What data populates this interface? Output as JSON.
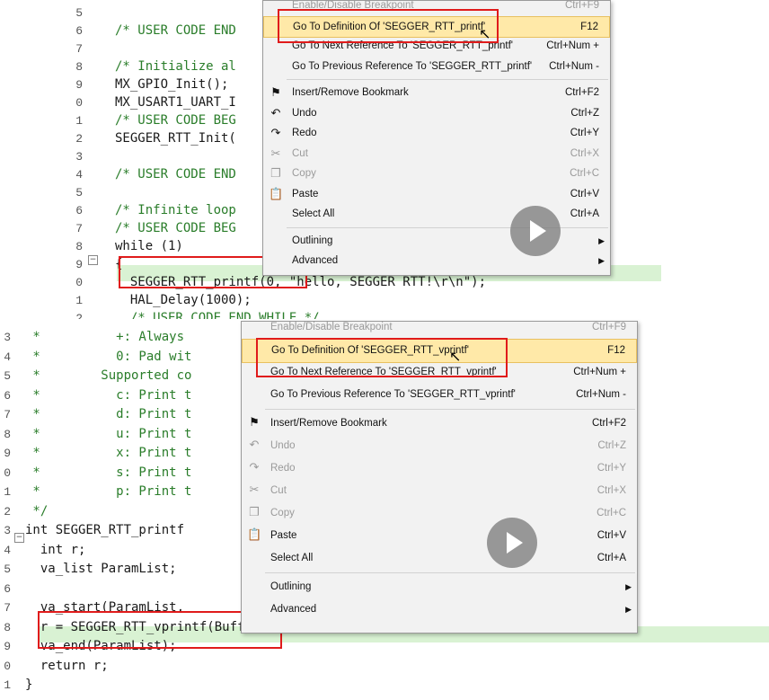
{
  "top_panel": {
    "code_lines": [
      {
        "ln": "5",
        "text": ""
      },
      {
        "ln": "6",
        "text": "/* USER CODE END",
        "cls": "cmt"
      },
      {
        "ln": "7",
        "text": ""
      },
      {
        "ln": "8",
        "text": "/* Initialize al",
        "cls": "cmt"
      },
      {
        "ln": "9",
        "text": "MX_GPIO_Init();"
      },
      {
        "ln": "0",
        "text": "MX_USART1_UART_I"
      },
      {
        "ln": "1",
        "text": "/* USER CODE BEG",
        "cls": "cmt"
      },
      {
        "ln": "2",
        "text": "SEGGER_RTT_Init("
      },
      {
        "ln": "3",
        "text": ""
      },
      {
        "ln": "4",
        "text": "/* USER CODE END",
        "cls": "cmt"
      },
      {
        "ln": "5",
        "text": ""
      },
      {
        "ln": "6",
        "text": "/* Infinite loop",
        "cls": "cmt"
      },
      {
        "ln": "7",
        "text": "/* USER CODE BEG",
        "cls": "cmt"
      },
      {
        "ln": "8",
        "text": "while (1)"
      },
      {
        "ln": "9",
        "text": "{"
      },
      {
        "ln": "0",
        "text": "  SEGGER_RTT_printf(0, \"hello, SEGGER RTT!\\r\\n\");"
      },
      {
        "ln": "1",
        "text": "  HAL_Delay(1000);"
      },
      {
        "ln": "2",
        "text": "  /* USER CODE END WHILE */",
        "cls": "cmt"
      }
    ],
    "menu": {
      "items": [
        {
          "label": "Enable/Disable Breakpoint",
          "shortcut": "Ctrl+F9",
          "disabled": true,
          "icon": ""
        },
        {
          "label": "Go To Definition Of 'SEGGER_RTT_printf'",
          "shortcut": "F12",
          "selected": true,
          "icon": ""
        },
        {
          "label": "Go To Next Reference To 'SEGGER_RTT_printf'",
          "shortcut": "Ctrl+Num +",
          "icon": ""
        },
        {
          "label": "Go To Previous Reference To 'SEGGER_RTT_printf'",
          "shortcut": "Ctrl+Num -",
          "icon": ""
        },
        {
          "label": "Insert/Remove Bookmark",
          "shortcut": "Ctrl+F2",
          "icon": "bookmark-icon"
        },
        {
          "label": "Undo",
          "shortcut": "Ctrl+Z",
          "icon": "undo-icon"
        },
        {
          "label": "Redo",
          "shortcut": "Ctrl+Y",
          "icon": "redo-icon"
        },
        {
          "label": "Cut",
          "shortcut": "Ctrl+X",
          "disabled": true,
          "icon": "cut-icon"
        },
        {
          "label": "Copy",
          "shortcut": "Ctrl+C",
          "disabled": true,
          "icon": "copy-icon"
        },
        {
          "label": "Paste",
          "shortcut": "Ctrl+V",
          "icon": "paste-icon"
        },
        {
          "label": "Select All",
          "shortcut": "Ctrl+A",
          "icon": ""
        },
        {
          "label": "Outlining",
          "submenu": true,
          "icon": ""
        },
        {
          "label": "Advanced",
          "submenu": true,
          "icon": ""
        }
      ]
    }
  },
  "bottom_panel": {
    "code_lines": [
      {
        "ln": "3",
        "text": " *          +: Always                                  ions",
        "cls": "cmt"
      },
      {
        "ln": "4",
        "text": " *          0: Pad wit                                 ng '-'-fla",
        "cls": "cmt"
      },
      {
        "ln": "5",
        "text": " *        Supported co",
        "cls": "cmt"
      },
      {
        "ln": "6",
        "text": " *          c: Print t",
        "cls": "cmt"
      },
      {
        "ln": "7",
        "text": " *          d: Print t",
        "cls": "cmt"
      },
      {
        "ln": "8",
        "text": " *          u: Print t",
        "cls": "cmt"
      },
      {
        "ln": "9",
        "text": " *          x: Print t",
        "cls": "cmt"
      },
      {
        "ln": "0",
        "text": " *          s: Print t",
        "cls": "cmt"
      },
      {
        "ln": "1",
        "text": " *          p: Print t                                 nteger. (A",
        "cls": "cmt"
      },
      {
        "ln": "2",
        "text": " */",
        "cls": "cmt"
      },
      {
        "ln": "3",
        "text": "int SEGGER_RTT_printf                                  rmat, ...)"
      },
      {
        "ln": "4",
        "text": "  int r;"
      },
      {
        "ln": "5",
        "text": "  va_list ParamList;"
      },
      {
        "ln": "6",
        "text": ""
      },
      {
        "ln": "7",
        "text": "  va_start(ParamList,"
      },
      {
        "ln": "8",
        "text": "  r = SEGGER_RTT_vprintf(BufferIndex, sFormat, &ParamList);"
      },
      {
        "ln": "9",
        "text": "  va_end(ParamList);"
      },
      {
        "ln": "0",
        "text": "  return r;"
      },
      {
        "ln": "1",
        "text": "}"
      }
    ],
    "menu": {
      "items": [
        {
          "label": "Enable/Disable Breakpoint",
          "shortcut": "Ctrl+F9",
          "disabled": true,
          "icon": ""
        },
        {
          "label": "Go To Definition Of 'SEGGER_RTT_vprintf'",
          "shortcut": "F12",
          "selected": true,
          "icon": ""
        },
        {
          "label": "Go To Next Reference To 'SEGGER_RTT_vprintf'",
          "shortcut": "Ctrl+Num +",
          "icon": ""
        },
        {
          "label": "Go To Previous Reference To 'SEGGER_RTT_vprintf'",
          "shortcut": "Ctrl+Num -",
          "icon": ""
        },
        {
          "label": "Insert/Remove Bookmark",
          "shortcut": "Ctrl+F2",
          "icon": "bookmark-icon"
        },
        {
          "label": "Undo",
          "shortcut": "Ctrl+Z",
          "disabled": true,
          "icon": "undo-icon"
        },
        {
          "label": "Redo",
          "shortcut": "Ctrl+Y",
          "disabled": true,
          "icon": "redo-icon"
        },
        {
          "label": "Cut",
          "shortcut": "Ctrl+X",
          "disabled": true,
          "icon": "cut-icon"
        },
        {
          "label": "Copy",
          "shortcut": "Ctrl+C",
          "disabled": true,
          "icon": "copy-icon"
        },
        {
          "label": "Paste",
          "shortcut": "Ctrl+V",
          "icon": "paste-icon"
        },
        {
          "label": "Select All",
          "shortcut": "Ctrl+A",
          "icon": ""
        },
        {
          "label": "Outlining",
          "submenu": true,
          "icon": ""
        },
        {
          "label": "Advanced",
          "submenu": true,
          "icon": ""
        }
      ]
    }
  },
  "icons": {
    "bookmark-icon": "⚑",
    "undo-icon": "↶",
    "redo-icon": "↷",
    "cut-icon": "✂",
    "copy-icon": "❐",
    "paste-icon": "📋",
    "submenu-arrow": "▶",
    "fold-collapse": "−",
    "cursor": "↖"
  },
  "colors": {
    "selected_bg": "#ffe9a8",
    "highlight_border": "#e01b1b",
    "comment": "#2a7d2a",
    "keyword": "#0000cc",
    "current_line": "#d9f2d3"
  }
}
